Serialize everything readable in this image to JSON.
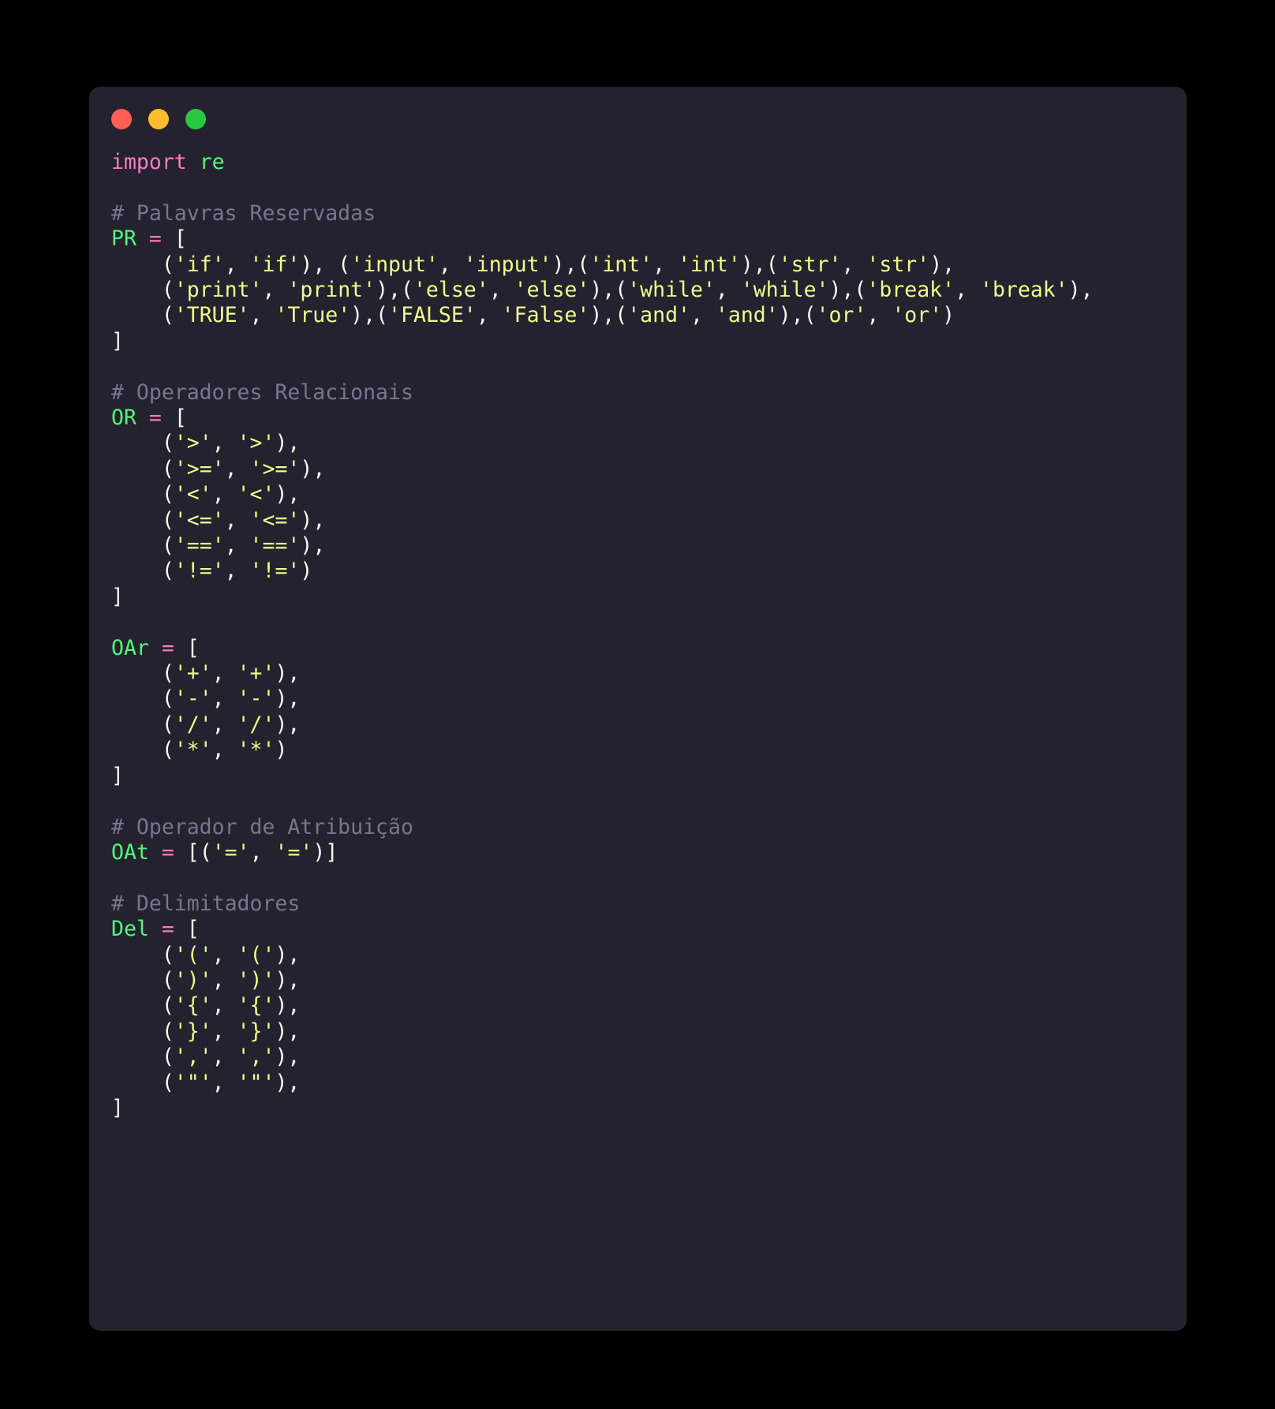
{
  "window": {
    "traffic_lights": [
      {
        "name": "close",
        "color": "#ff5f57"
      },
      {
        "name": "minimize",
        "color": "#febc2e"
      },
      {
        "name": "maximize",
        "color": "#28c840"
      }
    ],
    "background": "#23222e",
    "page_background": "#000000"
  },
  "theme": {
    "keyword": "#ff79c6",
    "variable": "#50fa7b",
    "operator": "#ff79c6",
    "string": "#f1fa8c",
    "punctuation": "#f8f8f2",
    "comment": "#7b7392"
  },
  "code": {
    "language": "python",
    "lines": [
      {
        "n": 1,
        "type": "import",
        "keyword": "import",
        "module": "re"
      },
      {
        "n": 2,
        "type": "blank"
      },
      {
        "n": 3,
        "type": "comment",
        "text": "# Palavras Reservadas"
      },
      {
        "n": 4,
        "type": "assign_open",
        "var": "PR",
        "op": "=",
        "bracket": "["
      },
      {
        "n": 5,
        "type": "raw",
        "text": "    ('if', 'if'), ('input', 'input'),('int', 'int'),('str', 'str'),"
      },
      {
        "n": 6,
        "type": "raw",
        "text": "    ('print', 'print'),('else', 'else'),('while', 'while'),('break', 'break'),"
      },
      {
        "n": 7,
        "type": "raw",
        "text": "    ('TRUE', 'True'),('FALSE', 'False'),('and', 'and'),('or', 'or')"
      },
      {
        "n": 8,
        "type": "close",
        "text": "]"
      },
      {
        "n": 9,
        "type": "blank"
      },
      {
        "n": 10,
        "type": "comment",
        "text": "# Operadores Relacionais"
      },
      {
        "n": 11,
        "type": "assign_open",
        "var": "OR",
        "op": "=",
        "bracket": "["
      },
      {
        "n": 12,
        "type": "raw",
        "text": "    ('>', '>'),"
      },
      {
        "n": 13,
        "type": "raw",
        "text": "    ('>=', '>='),"
      },
      {
        "n": 14,
        "type": "raw",
        "text": "    ('<', '<'),"
      },
      {
        "n": 15,
        "type": "raw",
        "text": "    ('<=', '<='),"
      },
      {
        "n": 16,
        "type": "raw",
        "text": "    ('==', '=='),"
      },
      {
        "n": 17,
        "type": "raw",
        "text": "    ('!=', '!=')"
      },
      {
        "n": 18,
        "type": "close",
        "text": "]"
      },
      {
        "n": 19,
        "type": "blank"
      },
      {
        "n": 20,
        "type": "assign_open",
        "var": "OAr",
        "op": "=",
        "bracket": "["
      },
      {
        "n": 21,
        "type": "raw",
        "text": "    ('+', '+'),"
      },
      {
        "n": 22,
        "type": "raw",
        "text": "    ('-', '-'),"
      },
      {
        "n": 23,
        "type": "raw",
        "text": "    ('/', '/'),"
      },
      {
        "n": 24,
        "type": "raw",
        "text": "    ('*', '*')"
      },
      {
        "n": 25,
        "type": "close",
        "text": "]"
      },
      {
        "n": 26,
        "type": "blank"
      },
      {
        "n": 27,
        "type": "comment",
        "text": "# Operador de Atribuição"
      },
      {
        "n": 28,
        "type": "assign_inline",
        "var": "OAt",
        "op": "=",
        "value": "[('=', '=')]"
      },
      {
        "n": 29,
        "type": "blank"
      },
      {
        "n": 30,
        "type": "comment",
        "text": "# Delimitadores"
      },
      {
        "n": 31,
        "type": "assign_open",
        "var": "Del",
        "op": "=",
        "bracket": "["
      },
      {
        "n": 32,
        "type": "raw",
        "text": "    ('(', '('),"
      },
      {
        "n": 33,
        "type": "raw",
        "text": "    (')', ')'),"
      },
      {
        "n": 34,
        "type": "raw",
        "text": "    ('{', '{'),"
      },
      {
        "n": 35,
        "type": "raw",
        "text": "    ('}', '}'),"
      },
      {
        "n": 36,
        "type": "raw",
        "text": "    (',', ','),"
      },
      {
        "n": 37,
        "type": "raw",
        "text": "    ('\"', '\"'),"
      },
      {
        "n": 38,
        "type": "close",
        "text": "]"
      }
    ]
  }
}
